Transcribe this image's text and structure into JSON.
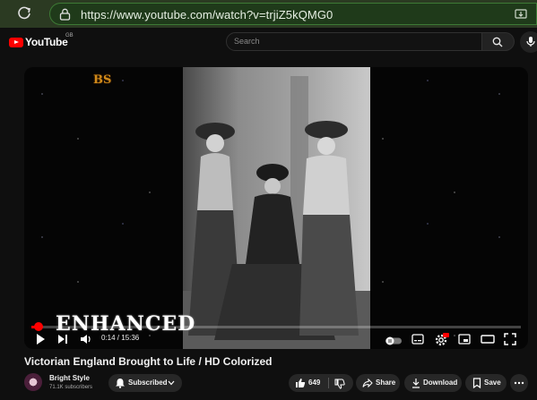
{
  "browser": {
    "url": "https://www.youtube.com/watch?v=trjiZ5kQMG0"
  },
  "header": {
    "logo_text": "YouTube",
    "country_code": "GB",
    "search_placeholder": "Search"
  },
  "video": {
    "overlay_logo": "BS",
    "overlay_text": "ENHANCED",
    "time_display": "0:14 / 15:36",
    "progress": 0.015,
    "accent_color": "#ff0000"
  },
  "meta": {
    "title": "Victorian England Brought to Life / HD Colorized",
    "channel_name": "Bright Style",
    "subscriber_count": "71.1K subscribers",
    "subscribed_label": "Subscribed",
    "like_count": "649",
    "share_label": "Share",
    "download_label": "Download",
    "save_label": "Save"
  }
}
